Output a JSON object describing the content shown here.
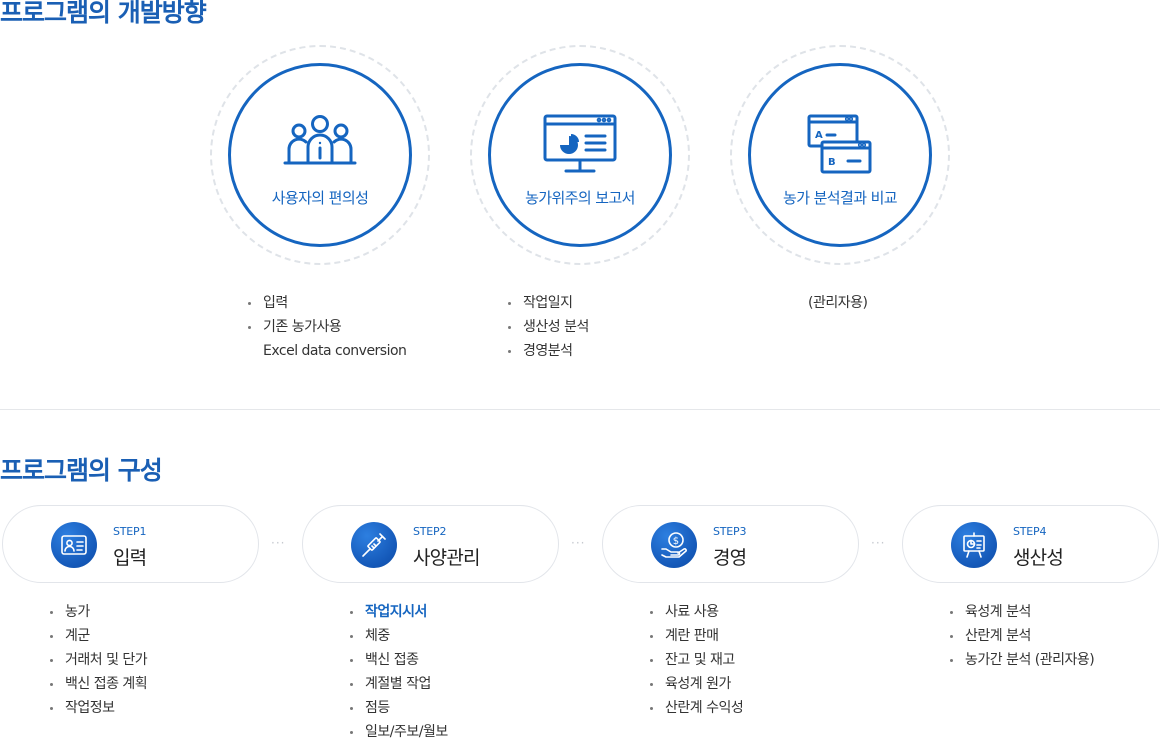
{
  "section1": {
    "title": "프로그램의 개발방향"
  },
  "directions": [
    {
      "label": "사용자의 편의성",
      "icon": "people-icon",
      "items": [
        "입력",
        "기존 농가사용"
      ],
      "note": "Excel data conversion"
    },
    {
      "label": "농가위주의 보고서",
      "icon": "report-monitor-icon",
      "items": [
        "작업일지",
        "생산성 분석",
        "경영분석"
      ]
    },
    {
      "label": "농가 분석결과 비교",
      "icon": "compare-windows-icon",
      "note": "(관리자용)"
    }
  ],
  "section2": {
    "title": "프로그램의 구성"
  },
  "separator": "···",
  "steps": [
    {
      "step": "STEP1",
      "name": "입력",
      "icon": "id-card-icon",
      "items": [
        "농가",
        "계군",
        "거래처 및 단가",
        "백신 접종 계획",
        "작업정보"
      ]
    },
    {
      "step": "STEP2",
      "name": "사양관리",
      "icon": "syringe-icon",
      "highlight": "작업지시서",
      "items": [
        "체중",
        "백신 접종",
        "계절별 작업",
        "점등",
        "일보/주보/월보"
      ]
    },
    {
      "step": "STEP3",
      "name": "경영",
      "icon": "money-hand-icon",
      "items": [
        "사료 사용",
        "계란 판매",
        "잔고 및 재고",
        "육성계 원가",
        "산란계 수익성"
      ]
    },
    {
      "step": "STEP4",
      "name": "생산성",
      "icon": "chart-board-icon",
      "items": [
        "육성계 분석",
        "산란계 분석",
        "농가간 분석 (관리자용)"
      ]
    }
  ],
  "colors": {
    "accent": "#1565c0",
    "title": "#1a5fb4",
    "ring": "#dfe3e8"
  }
}
